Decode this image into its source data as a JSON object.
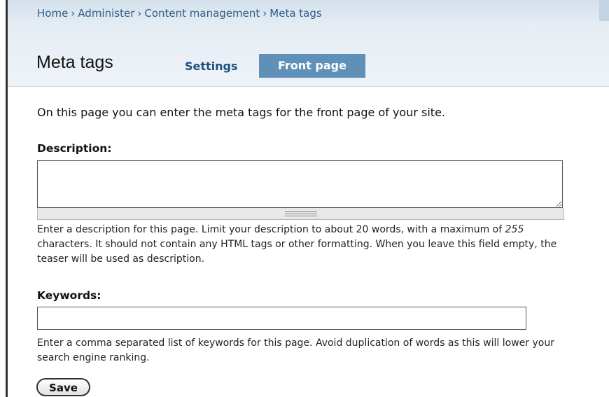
{
  "breadcrumb": {
    "items": [
      "Home",
      "Administer",
      "Content management",
      "Meta tags"
    ],
    "separator": "›"
  },
  "page": {
    "title": "Meta tags"
  },
  "tabs": {
    "settings": "Settings",
    "front_page": "Front page",
    "active": "Front page"
  },
  "intro": "On this page you can enter the meta tags for the front page of your site.",
  "description": {
    "label": "Description:",
    "value": "",
    "help_part1": "Enter a description for this page. Limit your description to about 20 words, with a maximum of ",
    "help_number": "255",
    "help_part2": " characters. It should not contain any HTML tags or other formatting. When you leave this field empty, the teaser will be used as description."
  },
  "keywords": {
    "label": "Keywords:",
    "value": "",
    "help": "Enter a comma separated list of keywords for this page. Avoid duplication of words as this will lower your search engine ranking."
  },
  "save_button": "Save",
  "colors": {
    "active_tab": "#5f90b8",
    "link": "#1e4f80",
    "header_bg": "#e6edf4"
  }
}
